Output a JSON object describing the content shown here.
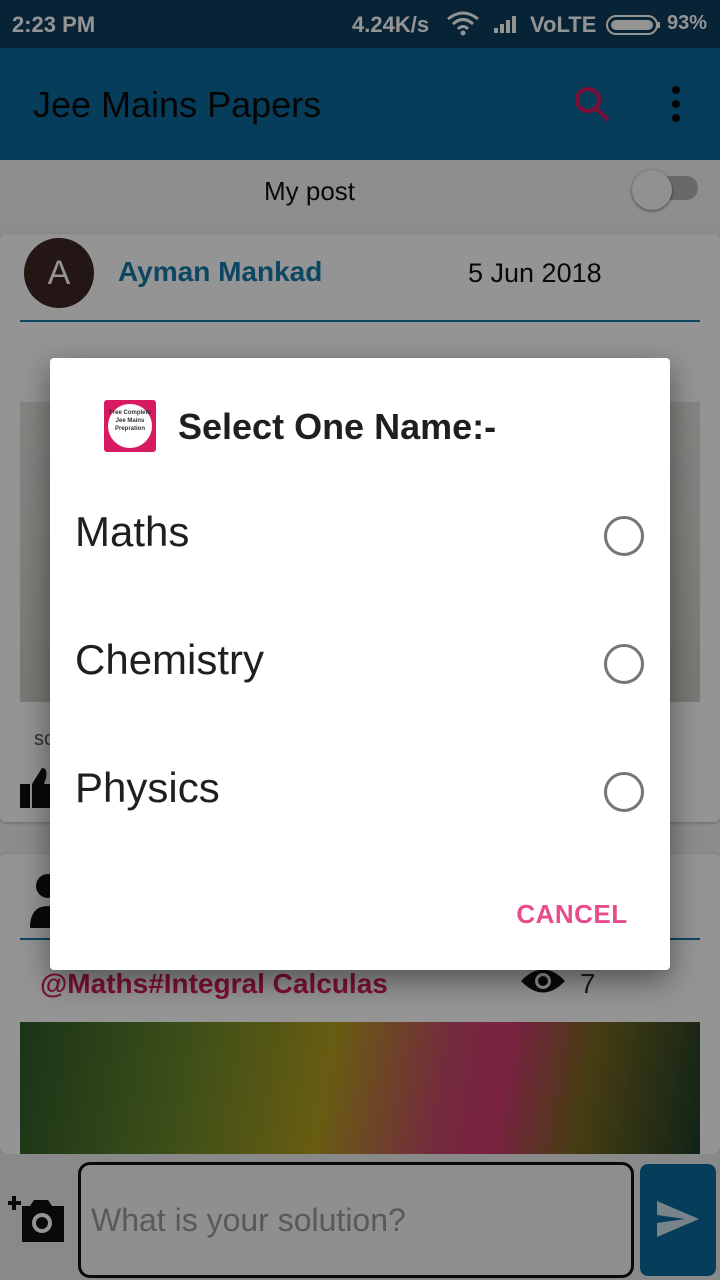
{
  "status_bar": {
    "time": "2:23 PM",
    "net_speed": "4.24K/s",
    "network": "VoLTE",
    "battery": "93%",
    "icons": [
      "wifi-icon",
      "signal-icon",
      "battery-icon"
    ]
  },
  "app_bar": {
    "title": "Jee Mains Papers",
    "icons": [
      "search-icon",
      "overflow-menu-icon"
    ],
    "search_icon_color": "#d81b60"
  },
  "filter": {
    "label": "My post",
    "toggle_on": false
  },
  "posts": [
    {
      "avatar_letter": "A",
      "author": "Ayman Mankad",
      "date": "5 Jun 2018",
      "snippet": "so"
    },
    {
      "tag": "@Maths#Integral Calculas",
      "views": "7"
    }
  ],
  "composer": {
    "placeholder": "What is your solution?",
    "icons": [
      "add-photo-icon",
      "send-icon"
    ]
  },
  "dialog": {
    "title": "Select One Name:-",
    "app_icon_text": "Free Complete Jee Mains Prepration",
    "options": [
      {
        "label": "Maths",
        "selected": false
      },
      {
        "label": "Chemistry",
        "selected": false
      },
      {
        "label": "Physics",
        "selected": false
      }
    ],
    "cancel_label": "CANCEL"
  },
  "colors": {
    "status_bar": "#0d3d5c",
    "app_bar": "#0b6a9e",
    "accent": "#e84c8a",
    "author": "#1579a8",
    "tag": "#d81b60"
  }
}
